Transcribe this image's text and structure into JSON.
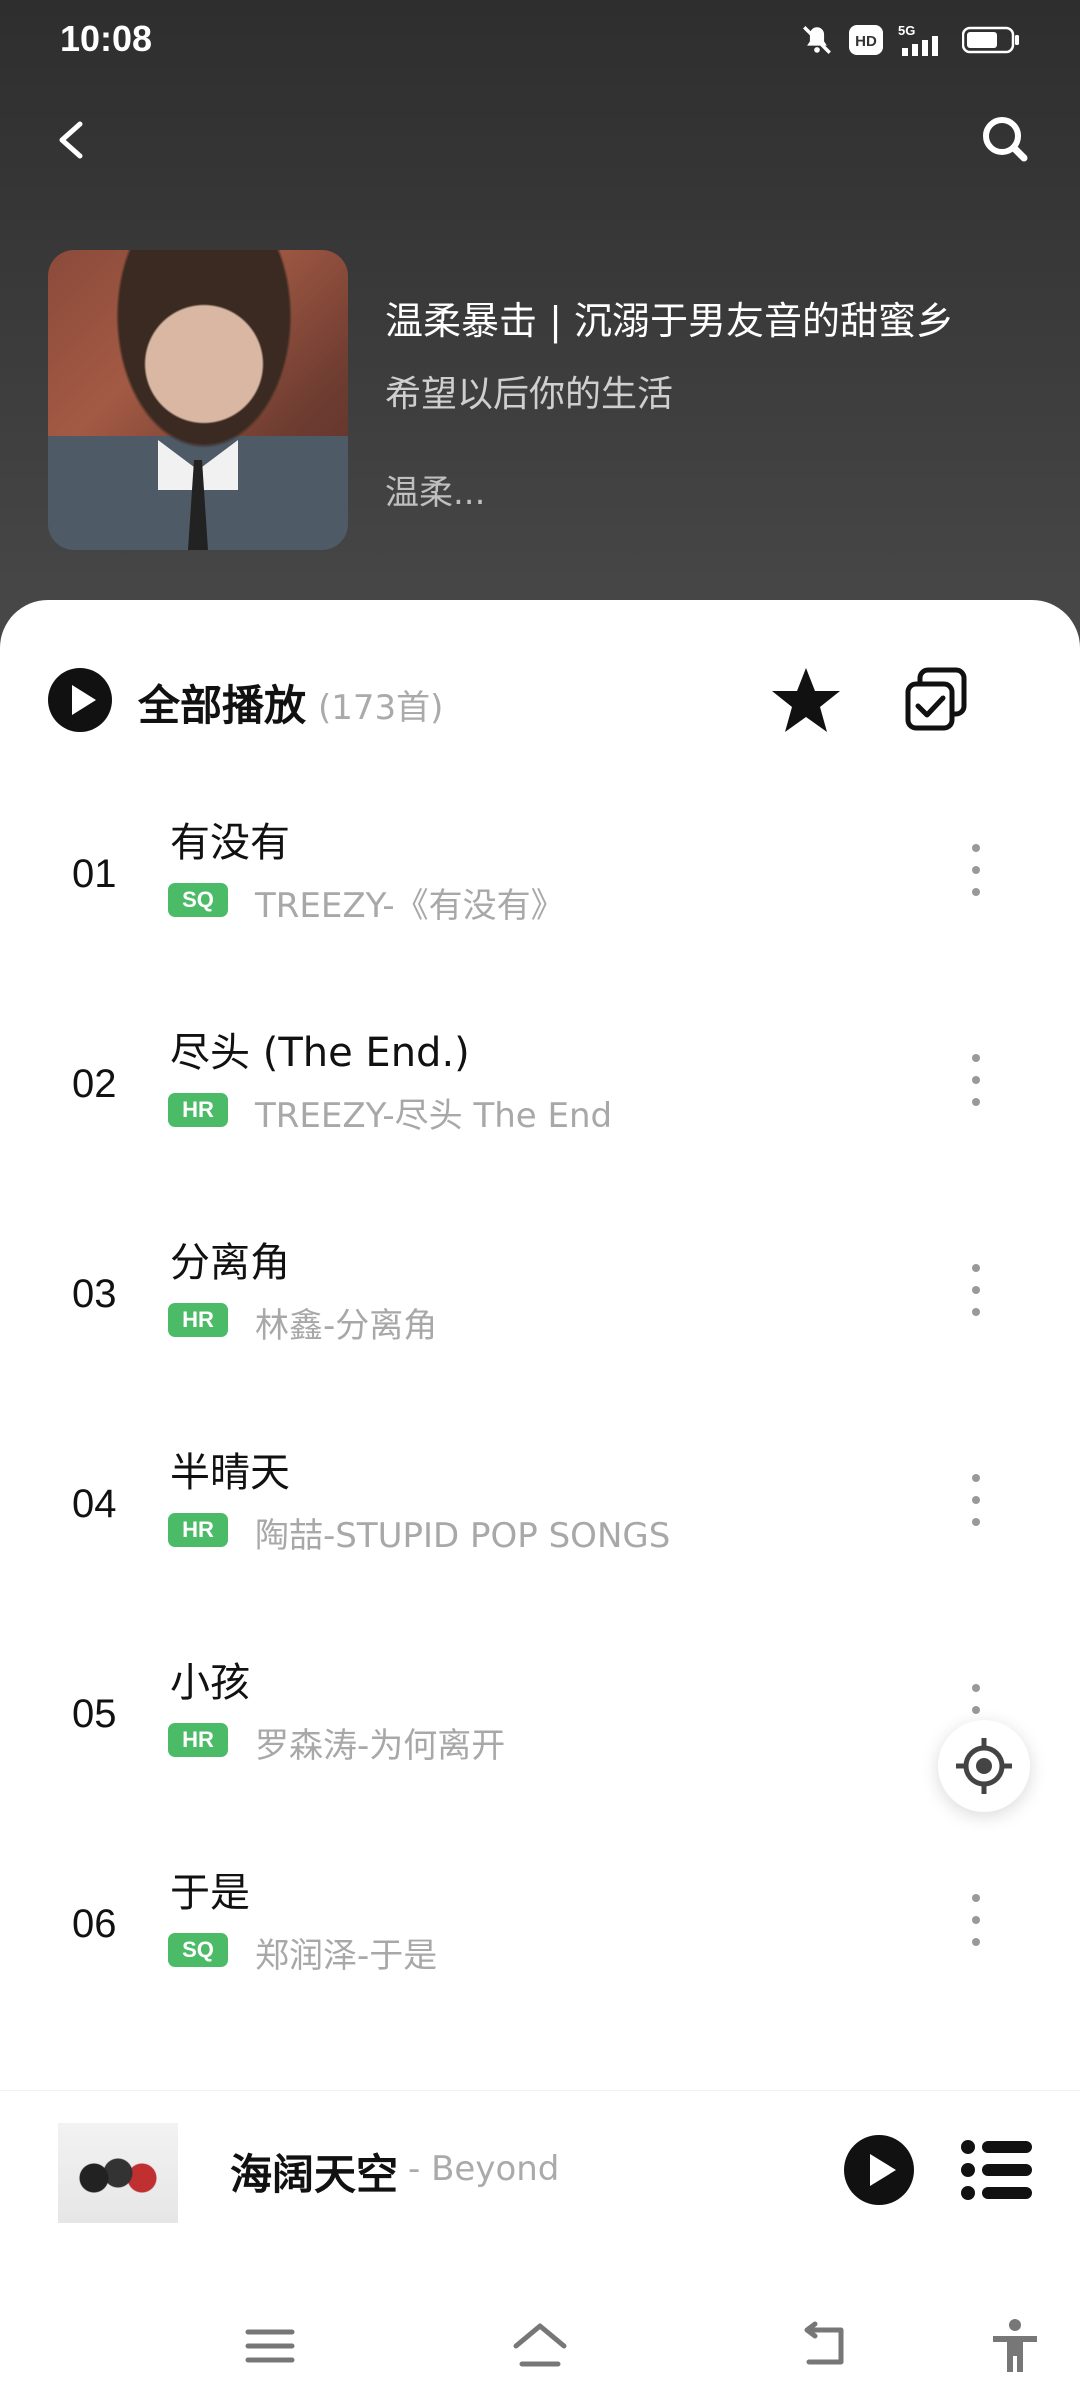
{
  "status_bar": {
    "time": "10:08",
    "icons": [
      "mute-bell-icon",
      "hd-icon",
      "5g-signal-icon",
      "battery-icon"
    ],
    "hd_label": "HD",
    "network_label": "5G"
  },
  "nav": {
    "back_icon": "back-arrow-icon",
    "search_icon": "search-icon"
  },
  "playlist": {
    "title": "温柔暴击 | 沉溺于男友音的甜蜜乡",
    "description": "希望以后你的生活",
    "tag": "温柔..."
  },
  "actions": {
    "play_all_label": "全部播放",
    "count": "(173首)",
    "favorite_icon": "star-icon",
    "multi_select_icon": "multi-select-icon"
  },
  "songs": [
    {
      "index": "01",
      "title": "有没有",
      "quality": "SQ",
      "meta": "TREEZY-《有没有》"
    },
    {
      "index": "02",
      "title": "尽头 (The End.)",
      "quality": "HR",
      "meta": "TREEZY-尽头 The End"
    },
    {
      "index": "03",
      "title": "分离角",
      "quality": "HR",
      "meta": "林鑫-分离角"
    },
    {
      "index": "04",
      "title": "半晴天",
      "quality": "HR",
      "meta": "陶喆-STUPID POP SONGS"
    },
    {
      "index": "05",
      "title": "小孩",
      "quality": "HR",
      "meta": "罗森涛-为何离开"
    },
    {
      "index": "06",
      "title": "于是",
      "quality": "SQ",
      "meta": "郑润泽-于是"
    }
  ],
  "now_playing": {
    "title": "海阔天空",
    "artist": "- Beyond"
  },
  "colors": {
    "header_bg": "#3a3a3a",
    "badge_green": "#4cbb68",
    "text_primary": "#111111",
    "text_secondary": "#a8a8a8"
  }
}
